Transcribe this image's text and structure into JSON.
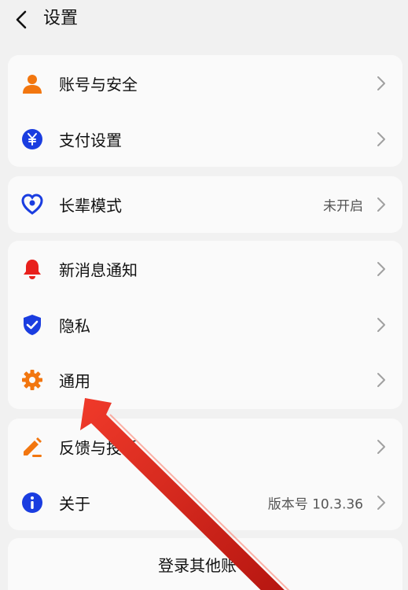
{
  "header": {
    "title": "设置"
  },
  "cards": [
    {
      "items": [
        {
          "label": "账号与安全",
          "icon": "person-icon",
          "value": ""
        },
        {
          "label": "支付设置",
          "icon": "yuan-icon",
          "value": ""
        }
      ]
    },
    {
      "items": [
        {
          "label": "长辈模式",
          "icon": "heart-icon",
          "value": "未开启"
        }
      ]
    },
    {
      "items": [
        {
          "label": "新消息通知",
          "icon": "bell-icon",
          "value": ""
        },
        {
          "label": "隐私",
          "icon": "shield-icon",
          "value": ""
        },
        {
          "label": "通用",
          "icon": "gear-icon",
          "value": ""
        }
      ]
    },
    {
      "items": [
        {
          "label": "反馈与投诉",
          "icon": "edit-icon",
          "value": ""
        },
        {
          "label": "关于",
          "icon": "info-icon",
          "value": "版本号 10.3.36"
        }
      ]
    }
  ],
  "login_other": "登录其他账号",
  "colors": {
    "orange": "#f2760f",
    "blue": "#1a3de0",
    "red": "#e8201c",
    "arrow": "#d4201a"
  }
}
